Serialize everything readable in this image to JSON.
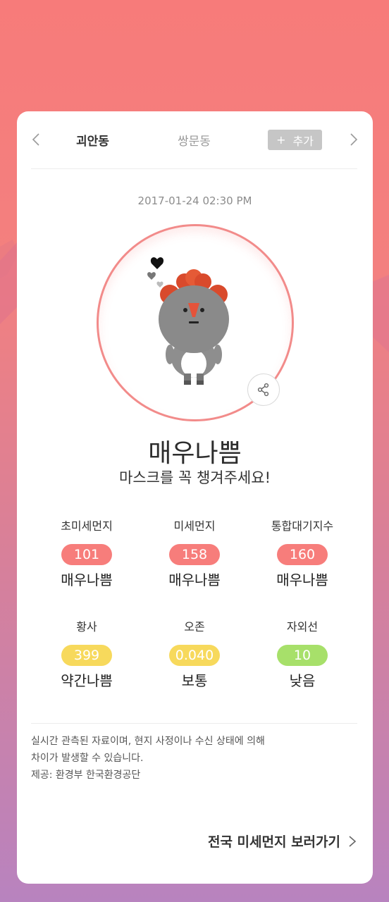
{
  "header": {
    "active_location": "괴안동",
    "other_location": "쌍문동",
    "add_button": "추가",
    "add_symbol": "+"
  },
  "timestamp": "2017-01-24 02:30 PM",
  "status": {
    "grade": "매우나쁨",
    "message": "마스크를 꼭 챙겨주세요!"
  },
  "metrics": [
    {
      "label": "초미세먼지",
      "value": "101",
      "grade": "매우나쁨",
      "color": "#f77d7b"
    },
    {
      "label": "미세먼지",
      "value": "158",
      "grade": "매우나쁨",
      "color": "#f77d7b"
    },
    {
      "label": "통합대기지수",
      "value": "160",
      "grade": "매우나쁨",
      "color": "#f77d7b"
    },
    {
      "label": "황사",
      "value": "399",
      "grade": "약간나쁨",
      "color": "#f7d95c"
    },
    {
      "label": "오존",
      "value": "0.040",
      "grade": "보통",
      "color": "#f7d95c"
    },
    {
      "label": "자외선",
      "value": "10",
      "grade": "낮음",
      "color": "#a7e06a"
    }
  ],
  "notice": {
    "line1": "실시간 관측된 자료이며, 현지 사정이나 수신 상태에 의해",
    "line2": "차이가 발생할 수 있습니다.",
    "line3": "제공: 환경부 한국환경공단"
  },
  "footer": {
    "link_label": "전국 미세먼지 보러가기"
  },
  "icons": {
    "prev": "chevron-left-icon",
    "next": "chevron-right-icon",
    "share": "share-icon",
    "footer": "chevron-right-icon"
  }
}
